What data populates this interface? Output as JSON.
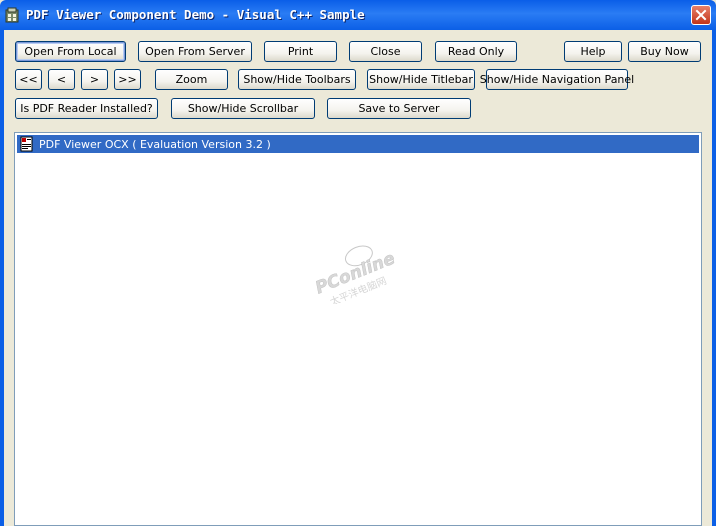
{
  "window": {
    "title": "PDF Viewer Component Demo - Visual C++ Sample"
  },
  "toolbar": {
    "row1": [
      {
        "id": "open-from-local-button",
        "label": "Open From Local"
      },
      {
        "id": "open-from-server-button",
        "label": "Open From Server"
      },
      {
        "id": "print-button",
        "label": "Print"
      },
      {
        "id": "close-button",
        "label": "Close"
      },
      {
        "id": "read-only-button",
        "label": "Read Only"
      },
      {
        "id": "help-button",
        "label": "Help"
      },
      {
        "id": "buy-now-button",
        "label": "Buy Now"
      }
    ],
    "row2": [
      {
        "id": "first-page-button",
        "label": "<<"
      },
      {
        "id": "previous-page-button",
        "label": "<"
      },
      {
        "id": "next-page-button",
        "label": ">"
      },
      {
        "id": "last-page-button",
        "label": ">>"
      },
      {
        "id": "zoom-button",
        "label": "Zoom"
      },
      {
        "id": "show-hide-toolbars-button",
        "label": "Show/Hide Toolbars"
      },
      {
        "id": "show-hide-titlebar-button",
        "label": "Show/Hide Titlebar"
      },
      {
        "id": "show-hide-navigation-panel-button",
        "label": "Show/Hide Navigation Panel"
      }
    ],
    "row3": [
      {
        "id": "is-pdf-reader-installed-button",
        "label": "Is PDF Reader Installed?"
      },
      {
        "id": "show-hide-scrollbar-button",
        "label": "Show/Hide Scrollbar"
      },
      {
        "id": "save-to-server-button",
        "label": "Save to Server"
      }
    ]
  },
  "viewer": {
    "label": "PDF Viewer OCX ( Evaluation Version 3.2 )",
    "icon": "document-icon",
    "selection_color": "#316ac5"
  },
  "watermark": {
    "text": "PConline",
    "subtext": "太平洋电脑网"
  },
  "colors": {
    "titlebar": "#0b5fe6",
    "dialog_bg": "#ece9d8",
    "close_button": "#c2351a"
  }
}
